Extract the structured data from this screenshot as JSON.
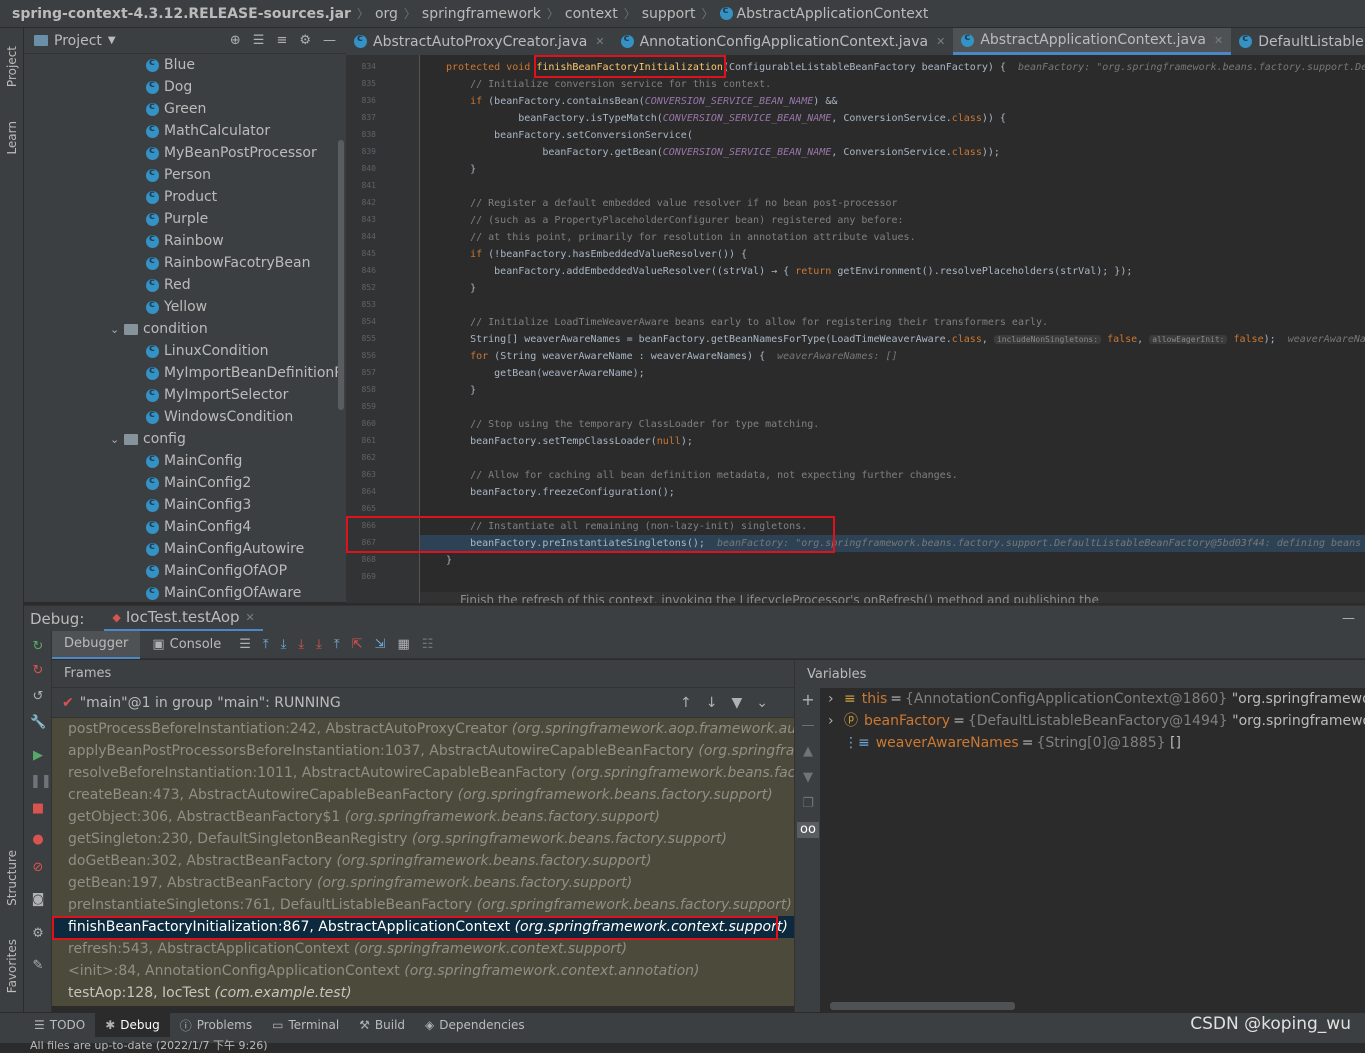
{
  "breadcrumb": [
    "spring-context-4.3.12.RELEASE-sources.jar",
    "org",
    "springframework",
    "context",
    "support",
    "AbstractApplicationContext"
  ],
  "left_strip": {
    "project": "Project",
    "learn": "Learn",
    "structure": "Structure",
    "favorites": "Favorites"
  },
  "project_panel": {
    "title": "Project",
    "items": [
      {
        "label": "Blue",
        "kind": "class",
        "level": 2
      },
      {
        "label": "Dog",
        "kind": "class",
        "level": 2
      },
      {
        "label": "Green",
        "kind": "class",
        "level": 2
      },
      {
        "label": "MathCalculator",
        "kind": "class",
        "level": 2
      },
      {
        "label": "MyBeanPostProcessor",
        "kind": "class",
        "level": 2
      },
      {
        "label": "Person",
        "kind": "class",
        "level": 2
      },
      {
        "label": "Product",
        "kind": "class",
        "level": 2
      },
      {
        "label": "Purple",
        "kind": "class",
        "level": 2
      },
      {
        "label": "Rainbow",
        "kind": "class",
        "level": 2
      },
      {
        "label": "RainbowFacotryBean",
        "kind": "class",
        "level": 2
      },
      {
        "label": "Red",
        "kind": "class",
        "level": 2
      },
      {
        "label": "Yellow",
        "kind": "class",
        "level": 2
      },
      {
        "label": "condition",
        "kind": "folder",
        "level": 1
      },
      {
        "label": "LinuxCondition",
        "kind": "class",
        "level": 2
      },
      {
        "label": "MyImportBeanDefinitionR",
        "kind": "class",
        "level": 2
      },
      {
        "label": "MyImportSelector",
        "kind": "class",
        "level": 2
      },
      {
        "label": "WindowsCondition",
        "kind": "class",
        "level": 2
      },
      {
        "label": "config",
        "kind": "folder",
        "level": 1
      },
      {
        "label": "MainConfig",
        "kind": "class",
        "level": 2
      },
      {
        "label": "MainConfig2",
        "kind": "class",
        "level": 2
      },
      {
        "label": "MainConfig3",
        "kind": "class",
        "level": 2
      },
      {
        "label": "MainConfig4",
        "kind": "class",
        "level": 2
      },
      {
        "label": "MainConfigAutowire",
        "kind": "class",
        "level": 2
      },
      {
        "label": "MainConfigOfAOP",
        "kind": "class",
        "level": 2
      },
      {
        "label": "MainConfigOfAware",
        "kind": "class",
        "level": 2
      }
    ]
  },
  "editor_tabs": [
    {
      "label": "AbstractAutoProxyCreator.java",
      "active": false
    },
    {
      "label": "AnnotationConfigApplicationContext.java",
      "active": false
    },
    {
      "label": "AbstractApplicationContext.java",
      "active": true
    },
    {
      "label": "DefaultListable",
      "active": false
    }
  ],
  "code_lines": [
    {
      "n": "834",
      "segs": [
        [
          "kw",
          "protected void "
        ],
        [
          "hl",
          "finishBeanFactoryInitialization"
        ],
        [
          "t",
          "(ConfigurableListableBeanFactory beanFactory) {  "
        ],
        [
          "hint",
          "beanFactory: \"org.springframework.beans.factory.support.De"
        ]
      ]
    },
    {
      "n": "835",
      "segs": [
        [
          "cm",
          "    // Initialize conversion service for this context."
        ]
      ]
    },
    {
      "n": "836",
      "segs": [
        [
          "kw",
          "    if "
        ],
        [
          "t",
          "(beanFactory.containsBean("
        ],
        [
          "cn",
          "CONVERSION_SERVICE_BEAN_NAME"
        ],
        [
          "t",
          ") &&"
        ]
      ]
    },
    {
      "n": "837",
      "segs": [
        [
          "t",
          "            beanFactory.isTypeMatch("
        ],
        [
          "cn",
          "CONVERSION_SERVICE_BEAN_NAME"
        ],
        [
          "t",
          ", ConversionService."
        ],
        [
          "kw",
          "class"
        ],
        [
          "t",
          ")) {"
        ]
      ]
    },
    {
      "n": "838",
      "segs": [
        [
          "t",
          "        beanFactory.setConversionService("
        ]
      ]
    },
    {
      "n": "839",
      "segs": [
        [
          "t",
          "                beanFactory.getBean("
        ],
        [
          "cn",
          "CONVERSION_SERVICE_BEAN_NAME"
        ],
        [
          "t",
          ", ConversionService."
        ],
        [
          "kw",
          "class"
        ],
        [
          "t",
          "));"
        ]
      ]
    },
    {
      "n": "840",
      "segs": [
        [
          "t",
          "    }"
        ]
      ]
    },
    {
      "n": "841",
      "segs": []
    },
    {
      "n": "842",
      "segs": [
        [
          "cm",
          "    // Register a default embedded value resolver if no bean post-processor"
        ]
      ]
    },
    {
      "n": "843",
      "segs": [
        [
          "cm",
          "    // (such as a PropertyPlaceholderConfigurer bean) registered any before:"
        ]
      ]
    },
    {
      "n": "844",
      "segs": [
        [
          "cm",
          "    // at this point, primarily for resolution in annotation attribute values."
        ]
      ]
    },
    {
      "n": "845",
      "segs": [
        [
          "kw",
          "    if "
        ],
        [
          "t",
          "(!beanFactory.hasEmbeddedValueResolver()) {"
        ]
      ]
    },
    {
      "n": "846",
      "segs": [
        [
          "t",
          "        beanFactory.addEmbeddedValueResolver((strVal) → { "
        ],
        [
          "kw",
          "return "
        ],
        [
          "t",
          "getEnvironment().resolvePlaceholders(strVal); });"
        ]
      ]
    },
    {
      "n": "852",
      "segs": [
        [
          "t",
          "    }"
        ]
      ]
    },
    {
      "n": "853",
      "segs": []
    },
    {
      "n": "854",
      "segs": [
        [
          "cm",
          "    // Initialize LoadTimeWeaverAware beans early to allow for registering their transformers early."
        ]
      ]
    },
    {
      "n": "855",
      "segs": [
        [
          "t",
          "    String[] weaverAwareNames = beanFactory.getBeanNamesForType(LoadTimeWeaverAware."
        ],
        [
          "kw",
          "class"
        ],
        [
          "t",
          ", "
        ],
        [
          "ih",
          "includeNonSingletons:"
        ],
        [
          "kw",
          " false"
        ],
        [
          "t",
          ", "
        ],
        [
          "ih",
          "allowEagerInit:"
        ],
        [
          "kw",
          " false"
        ],
        [
          "t",
          ");  "
        ],
        [
          "hint",
          "weaverAwareNames"
        ]
      ]
    },
    {
      "n": "856",
      "segs": [
        [
          "kw",
          "    for "
        ],
        [
          "t",
          "(String weaverAwareName : weaverAwareNames) {  "
        ],
        [
          "hint",
          "weaverAwareNames: []"
        ]
      ]
    },
    {
      "n": "857",
      "segs": [
        [
          "t",
          "        getBean(weaverAwareName);"
        ]
      ]
    },
    {
      "n": "858",
      "segs": [
        [
          "t",
          "    }"
        ]
      ]
    },
    {
      "n": "859",
      "segs": []
    },
    {
      "n": "860",
      "segs": [
        [
          "cm",
          "    // Stop using the temporary ClassLoader for type matching."
        ]
      ]
    },
    {
      "n": "861",
      "segs": [
        [
          "t",
          "    beanFactory.setTempClassLoader("
        ],
        [
          "kw",
          "null"
        ],
        [
          "t",
          ");"
        ]
      ]
    },
    {
      "n": "862",
      "segs": []
    },
    {
      "n": "863",
      "segs": [
        [
          "cm",
          "    // Allow for caching all bean definition metadata, not expecting further changes."
        ]
      ]
    },
    {
      "n": "864",
      "segs": [
        [
          "t",
          "    beanFactory.freezeConfiguration();"
        ]
      ]
    },
    {
      "n": "865",
      "segs": []
    },
    {
      "n": "866",
      "segs": [
        [
          "cm",
          "    // Instantiate all remaining (non-lazy-init) singletons."
        ]
      ]
    },
    {
      "n": "867",
      "segs": [
        [
          "t",
          "    beanFactory.preInstantiateSingletons();  "
        ],
        [
          "hint",
          "beanFactory: \"org.springframework.beans.factory.support.DefaultListableBeanFactory@5bd03f44: defining beans"
        ]
      ],
      "exec": true
    },
    {
      "n": "868",
      "segs": [
        [
          "t",
          "}"
        ]
      ]
    },
    {
      "n": "869",
      "segs": []
    }
  ],
  "code_footer_doc": "Finish the refresh of this context, invoking the LifecycleProcessor's onRefresh() method and publishing the",
  "debug": {
    "title": "Debug:",
    "session": "IocTest.testAop",
    "tab_debugger": "Debugger",
    "tab_console": "Console",
    "frames_label": "Frames",
    "variables_label": "Variables",
    "thread": "\"main\"@1 in group \"main\": RUNNING",
    "frames": [
      {
        "method": "postProcessBeforeInstantiation:242, AbstractAutoProxyCreator",
        "pkg": "(org.springframework.aop.framework.auto"
      },
      {
        "method": "applyBeanPostProcessorsBeforeInstantiation:1037, AbstractAutowireCapableBeanFactory",
        "pkg": "(org.springfram"
      },
      {
        "method": "resolveBeforeInstantiation:1011, AbstractAutowireCapableBeanFactory",
        "pkg": "(org.springframework.beans.facto"
      },
      {
        "method": "createBean:473, AbstractAutowireCapableBeanFactory",
        "pkg": "(org.springframework.beans.factory.support)"
      },
      {
        "method": "getObject:306, AbstractBeanFactory$1",
        "pkg": "(org.springframework.beans.factory.support)"
      },
      {
        "method": "getSingleton:230, DefaultSingletonBeanRegistry",
        "pkg": "(org.springframework.beans.factory.support)"
      },
      {
        "method": "doGetBean:302, AbstractBeanFactory",
        "pkg": "(org.springframework.beans.factory.support)"
      },
      {
        "method": "getBean:197, AbstractBeanFactory",
        "pkg": "(org.springframework.beans.factory.support)"
      },
      {
        "method": "preInstantiateSingletons:761, DefaultListableBeanFactory",
        "pkg": "(org.springframework.beans.factory.support)"
      },
      {
        "method": "finishBeanFactoryInitialization:867, AbstractApplicationContext",
        "pkg": "(org.springframework.context.support)",
        "selected": true
      },
      {
        "method": "refresh:543, AbstractApplicationContext",
        "pkg": "(org.springframework.context.support)"
      },
      {
        "method": "<init>:84, AnnotationConfigApplicationContext",
        "pkg": "(org.springframework.context.annotation)"
      },
      {
        "method": "testAop:128, IocTest",
        "pkg": "(com.example.test)",
        "current": true
      }
    ],
    "variables": [
      {
        "name": "this",
        "type": "{AnnotationConfigApplicationContext@1860}",
        "value": "\"org.springframewor",
        "icon": "fields-icon"
      },
      {
        "name": "beanFactory",
        "type": "{DefaultListableBeanFactory@1494}",
        "value": "\"org.springframework",
        "icon": "parameter-icon"
      },
      {
        "name": "weaverAwareNames",
        "type": "{String[0]@1885}",
        "value": "[]",
        "icon": "array-icon"
      }
    ]
  },
  "bottom_tabs": [
    {
      "label": "TODO",
      "icon": "list-icon"
    },
    {
      "label": "Debug",
      "icon": "bug-icon",
      "active": true
    },
    {
      "label": "Problems",
      "icon": "info-icon"
    },
    {
      "label": "Terminal",
      "icon": "terminal-icon"
    },
    {
      "label": "Build",
      "icon": "hammer-icon"
    },
    {
      "label": "Dependencies",
      "icon": "layers-icon"
    }
  ],
  "status_text": "All files are up-to-date (2022/1/7 下午 9:26)",
  "watermark": "CSDN @koping_wu",
  "colors": {
    "highlight_box": "#e1101a",
    "selected_frame": "#0d293e",
    "accent": "#4a88c7"
  }
}
